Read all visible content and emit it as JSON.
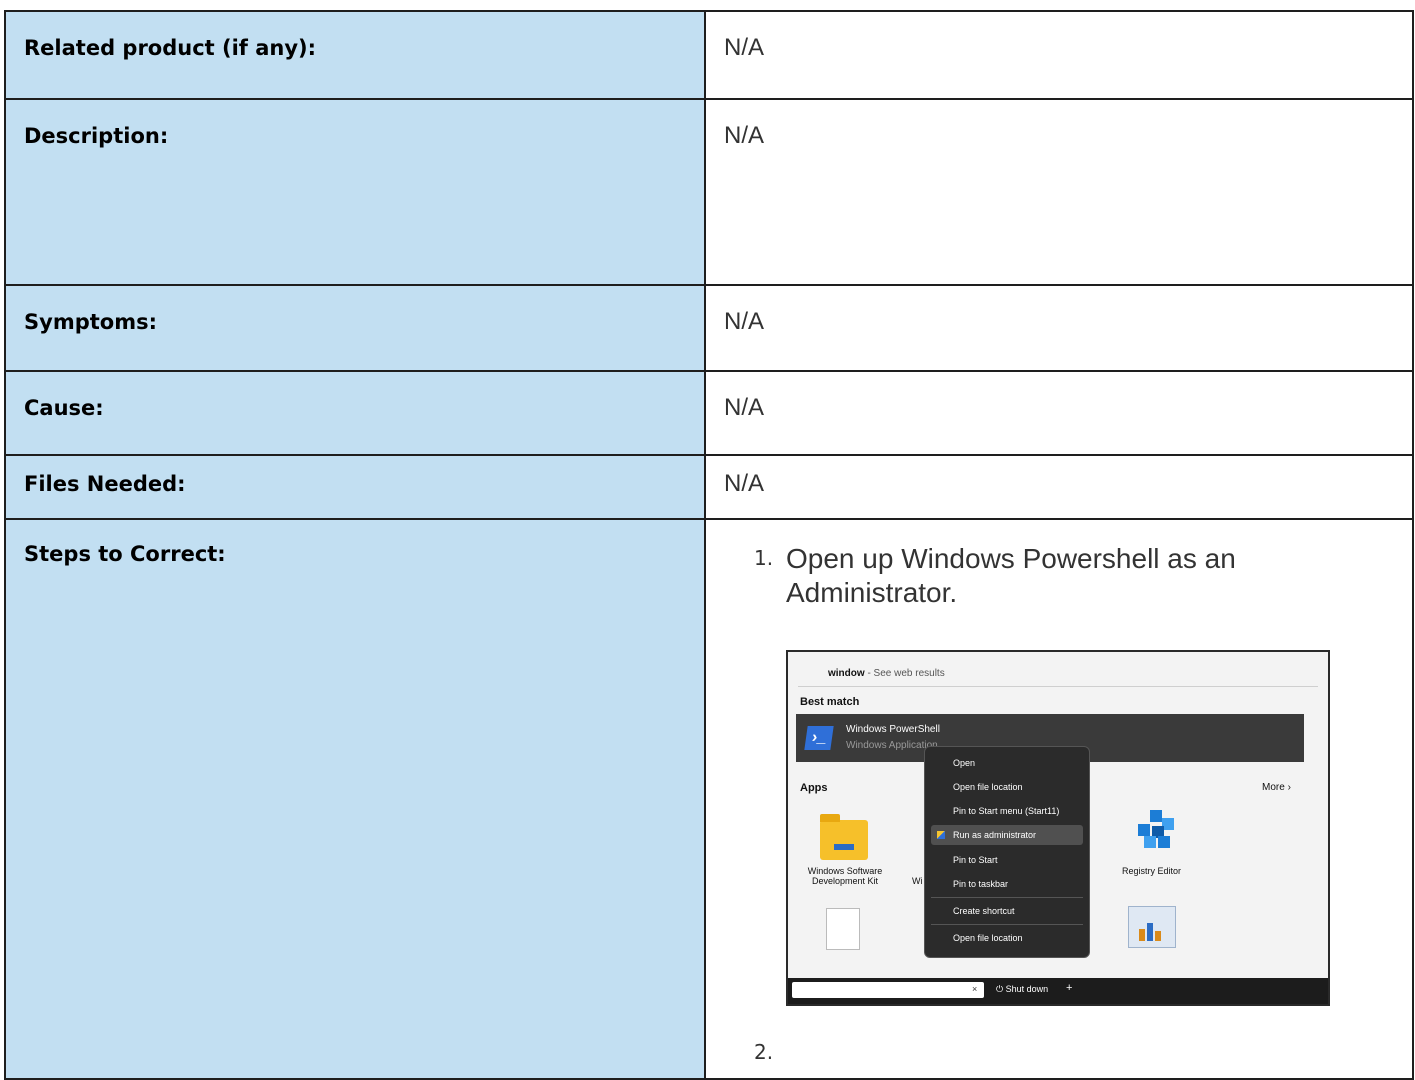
{
  "rows": {
    "related_product": {
      "label": "Related product (if any):",
      "value": "N/A"
    },
    "description": {
      "label": "Description:",
      "value": "N/A"
    },
    "symptoms": {
      "label": "Symptoms:",
      "value": "N/A"
    },
    "cause": {
      "label": "Cause:",
      "value": "N/A"
    },
    "files_needed": {
      "label": "Files Needed:",
      "value": "N/A"
    },
    "steps": {
      "label": "Steps to Correct:"
    }
  },
  "steps": [
    {
      "num": "1.",
      "text": "Open up Windows Powershell as an Administrator."
    },
    {
      "num": "2.",
      "text": ""
    }
  ],
  "screenshot": {
    "search_query": "window",
    "search_suffix": " - See web results",
    "best_match": "Best match",
    "app_name": "Windows PowerShell",
    "app_type": "Windows Application",
    "apps_heading": "Apps",
    "more_label": "More",
    "app1": "Windows Software Development Kit",
    "app2_partial": "Wi",
    "app3": "Registry Editor",
    "context_menu": [
      "Open",
      "Open file location",
      "Pin to Start menu (Start11)",
      "Run as administrator",
      "Pin to Start",
      "Pin to taskbar",
      "Create shortcut",
      "Open file location"
    ],
    "clear_icon": "×",
    "shutdown_label": "Shut down",
    "plus_label": "+",
    "more_chevron": "›",
    "ps_glyph": "›_"
  }
}
